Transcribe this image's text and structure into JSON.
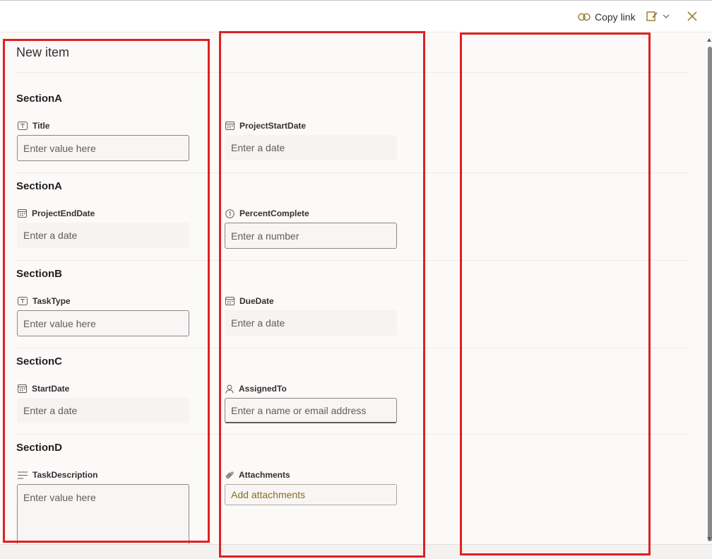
{
  "toolbar": {
    "copy_link_label": "Copy link"
  },
  "form": {
    "title": "New item",
    "sections": [
      {
        "title": "SectionA"
      },
      {
        "title": "SectionA"
      },
      {
        "title": "SectionB"
      },
      {
        "title": "SectionC"
      },
      {
        "title": "SectionD"
      }
    ],
    "fields": {
      "title": {
        "label": "Title",
        "placeholder": "Enter value here",
        "icon": "text-field-icon"
      },
      "project_start_date": {
        "label": "ProjectStartDate",
        "placeholder": "Enter a date",
        "icon": "calendar-icon"
      },
      "project_end_date": {
        "label": "ProjectEndDate",
        "placeholder": "Enter a date",
        "icon": "calendar-icon"
      },
      "percent_complete": {
        "label": "PercentComplete",
        "placeholder": "Enter a number",
        "icon": "number-icon"
      },
      "task_type": {
        "label": "TaskType",
        "placeholder": "Enter value here",
        "icon": "text-field-icon"
      },
      "due_date": {
        "label": "DueDate",
        "placeholder": "Enter a date",
        "icon": "calendar-icon"
      },
      "start_date": {
        "label": "StartDate",
        "placeholder": "Enter a date",
        "icon": "calendar-icon"
      },
      "assigned_to": {
        "label": "AssignedTo",
        "placeholder": "Enter a name or email address",
        "icon": "person-icon"
      },
      "task_description": {
        "label": "TaskDescription",
        "placeholder": "Enter value here",
        "icon": "multiline-text-icon"
      },
      "attachments": {
        "label": "Attachments",
        "placeholder": "Add attachments",
        "icon": "paperclip-icon"
      }
    }
  },
  "colors": {
    "annotation_box": "#e02020",
    "attachment_link": "#8a6d1c"
  }
}
